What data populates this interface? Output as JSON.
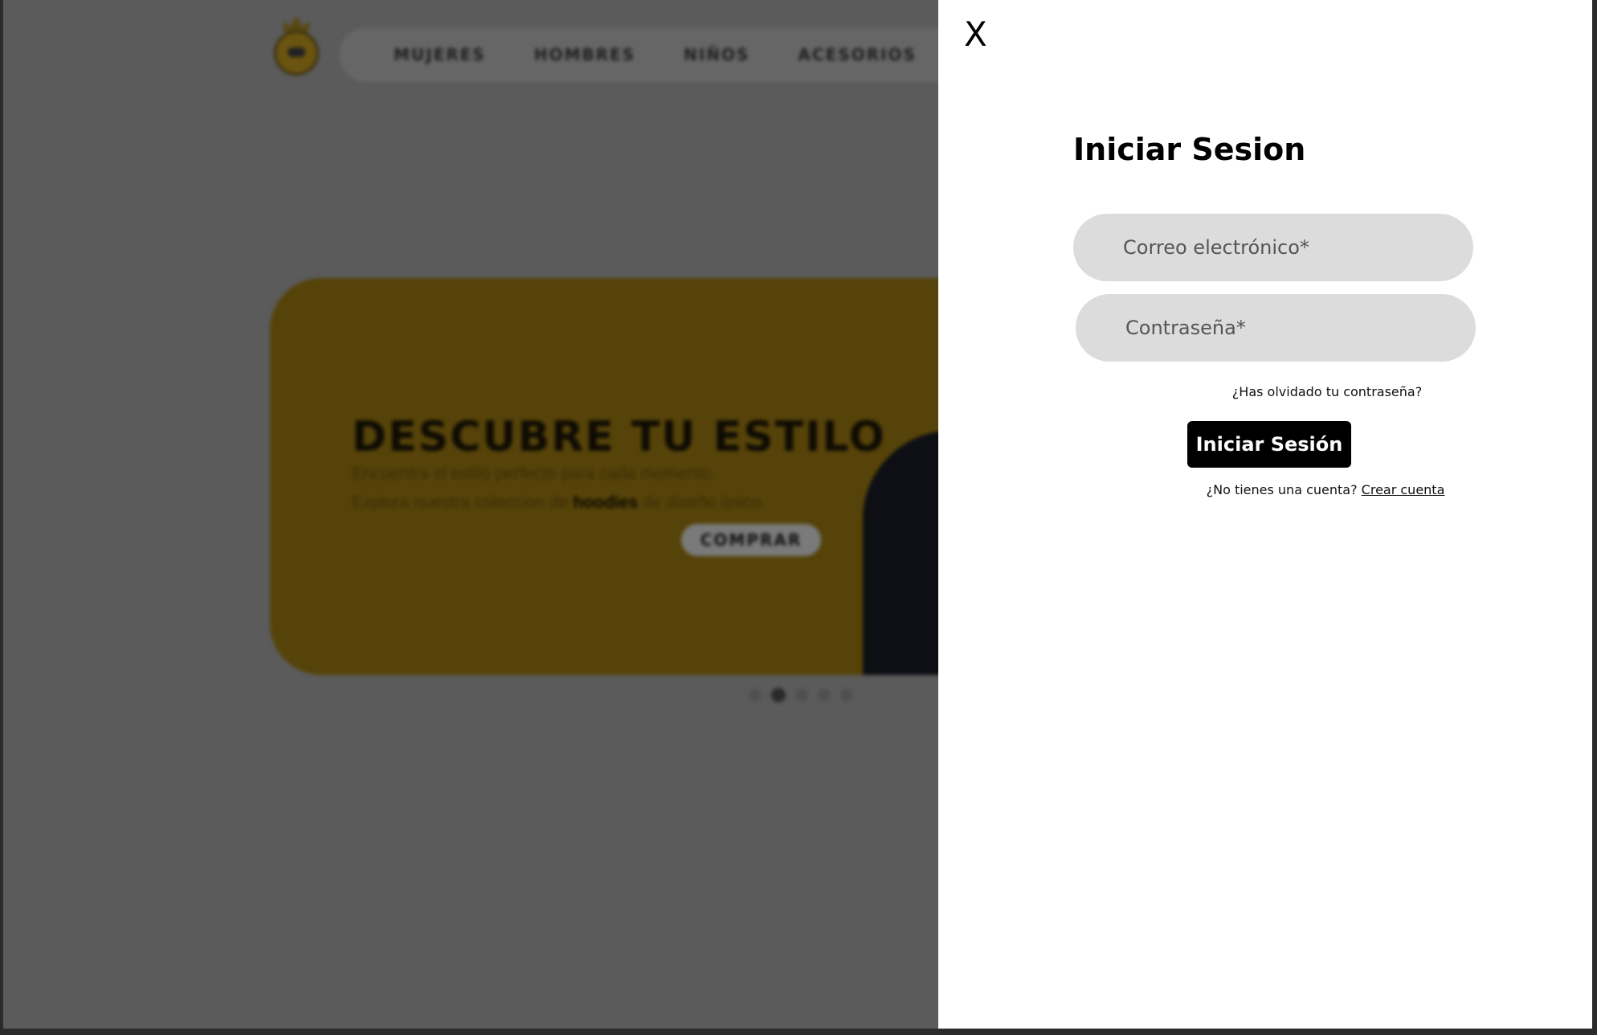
{
  "background": {
    "nav": {
      "items": [
        "MUJERES",
        "HOMBRES",
        "NIÑOS",
        "ACESORIOS"
      ]
    },
    "hero": {
      "title": "DESCUBRE TU ESTILO",
      "subtitle_line1": "Encuentra el estilo perfecto para cada momento.",
      "subtitle_line2_pre": "Explora nuestra coleccion de ",
      "subtitle_line2_bold": "hoodies",
      "subtitle_line2_post": " de diseño único.",
      "button_label": "COMPRAR",
      "accent_color": "#564309"
    },
    "carousel": {
      "count": 5,
      "active_index": 1
    }
  },
  "login_panel": {
    "close_label": "X",
    "title": "Iniciar Sesion",
    "email_placeholder": "Correo electrónico*",
    "password_placeholder": "Contraseña*",
    "forgot_password": "¿Has olvidado tu contraseña?",
    "submit_label": "Iniciar Sesión",
    "no_account_text": "¿No tienes una cuenta?",
    "create_account_link": "Crear cuenta"
  }
}
